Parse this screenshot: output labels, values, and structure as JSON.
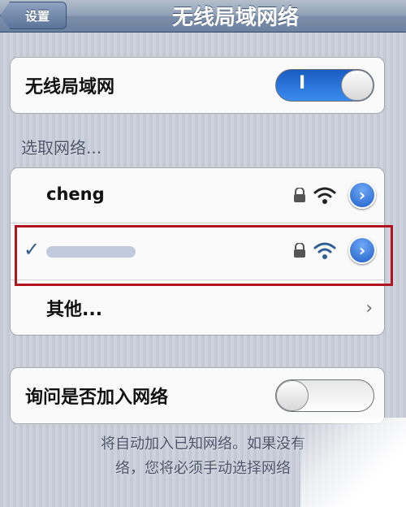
{
  "navbar": {
    "back_label": "设置",
    "title": "无线局域网络"
  },
  "wifi_section": {
    "label": "无线局域网",
    "toggle_on_text": "I"
  },
  "networks_section": {
    "header": "选取网络...",
    "networks": [
      {
        "name": "cheng",
        "selected": false,
        "secured": true
      },
      {
        "name": "",
        "selected": true,
        "secured": true
      }
    ],
    "checkmark": "✓",
    "disclosure": "›",
    "other_label": "其他...",
    "other_chevron": "›"
  },
  "ask_section": {
    "label": "询问是否加入网络",
    "toggle_state": "off"
  },
  "footer": {
    "line1": "将自动加入已知网络。如果没有",
    "line2": "络，您将必须手动选择网络"
  },
  "colors": {
    "toggle_on": "#2b75df",
    "highlight_box": "#b0141f",
    "disclosure": "#1f60c9"
  }
}
